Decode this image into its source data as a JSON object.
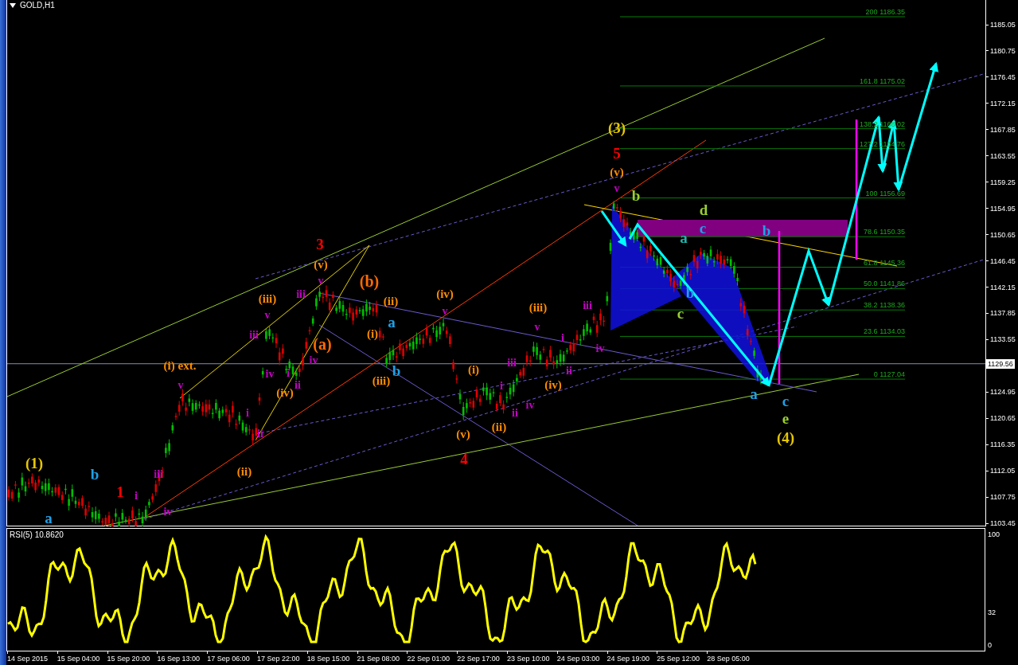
{
  "chart": {
    "title": "GOLD,H1"
  },
  "price_axis": {
    "labels": [
      "1185.05",
      "1180.75",
      "1176.45",
      "1172.15",
      "1167.85",
      "1163.55",
      "1159.25",
      "1154.95",
      "1150.65",
      "1146.45",
      "1142.15",
      "1137.85",
      "1133.55",
      "1124.95",
      "1120.65",
      "1116.35",
      "1112.05",
      "1107.75",
      "1103.45"
    ],
    "current_price": "1129.56"
  },
  "fib_levels": [
    "200 1186.35",
    "161.8 1175.02",
    "138.2 1168.02",
    "127.2 1164.76",
    "100 1156.69",
    "78.6 1150.35",
    "61.8 1145.36",
    "50.0 1141.86",
    "38.2 1138.36",
    "23.6 1134.03",
    "0 1127.04"
  ],
  "waves": [
    {
      "text": "(1)",
      "kind": "primary",
      "color": "#e6c700"
    },
    {
      "text": "a",
      "kind": "primary",
      "color": "#1ea0e6"
    },
    {
      "text": "b",
      "kind": "primary",
      "color": "#1ea0e6"
    },
    {
      "text": "1",
      "kind": "primary",
      "color": "#ff0000"
    },
    {
      "text": "i",
      "kind": "minute",
      "color": "#c000c0"
    },
    {
      "text": "iii",
      "kind": "minute",
      "color": "#c000c0"
    },
    {
      "text": "iv",
      "kind": "minute",
      "color": "#c000c0"
    },
    {
      "text": "(i) ext.",
      "kind": "minor",
      "color": "#ff8c00"
    },
    {
      "text": "v",
      "kind": "minute",
      "color": "#c000c0"
    },
    {
      "text": "i",
      "kind": "minute",
      "color": "#c000c0"
    },
    {
      "text": "ii",
      "kind": "minute",
      "color": "#c000c0"
    },
    {
      "text": "(ii)",
      "kind": "minor",
      "color": "#ff8c00"
    },
    {
      "text": "(iii)",
      "kind": "minor",
      "color": "#ff8c00"
    },
    {
      "text": "v",
      "kind": "minute",
      "color": "#c000c0"
    },
    {
      "text": "iii",
      "kind": "minute",
      "color": "#c000c0"
    },
    {
      "text": "iv",
      "kind": "minute",
      "color": "#c000c0"
    },
    {
      "text": "i",
      "kind": "minute",
      "color": "#c000c0"
    },
    {
      "text": "(iv)",
      "kind": "minor",
      "color": "#ff8c00"
    },
    {
      "text": "ii",
      "kind": "minute",
      "color": "#c000c0"
    },
    {
      "text": "iii",
      "kind": "minute",
      "color": "#c000c0"
    },
    {
      "text": "3",
      "kind": "primary",
      "color": "#ff0000"
    },
    {
      "text": "(v)",
      "kind": "minor",
      "color": "#ff8c00"
    },
    {
      "text": "v",
      "kind": "minute",
      "color": "#c000c0"
    },
    {
      "text": "(a)",
      "kind": "major",
      "color": "#ff6a00"
    },
    {
      "text": "iv",
      "kind": "minute",
      "color": "#c000c0"
    },
    {
      "text": "(b)",
      "kind": "major",
      "color": "#ff6a00"
    },
    {
      "text": "(ii)",
      "kind": "minor",
      "color": "#ff8c00"
    },
    {
      "text": "a",
      "kind": "primary",
      "color": "#1ea0e6"
    },
    {
      "text": "(i)",
      "kind": "minor",
      "color": "#ff8c00"
    },
    {
      "text": "b",
      "kind": "primary",
      "color": "#1ea0e6"
    },
    {
      "text": "(iii)",
      "kind": "minor",
      "color": "#ff8c00"
    },
    {
      "text": "(iv)",
      "kind": "minor",
      "color": "#ff8c00"
    },
    {
      "text": "v",
      "kind": "minute",
      "color": "#c000c0"
    },
    {
      "text": "(i)",
      "kind": "minor",
      "color": "#ff8c00"
    },
    {
      "text": "(v)",
      "kind": "minor",
      "color": "#ff8c00"
    },
    {
      "text": "4",
      "kind": "primary",
      "color": "#ff0000"
    },
    {
      "text": "(ii)",
      "kind": "minor",
      "color": "#ff8c00"
    },
    {
      "text": "i",
      "kind": "minute",
      "color": "#c000c0"
    },
    {
      "text": "ii",
      "kind": "minute",
      "color": "#c000c0"
    },
    {
      "text": "iii",
      "kind": "minute",
      "color": "#c000c0"
    },
    {
      "text": "iv",
      "kind": "minute",
      "color": "#c000c0"
    },
    {
      "text": "(iii)",
      "kind": "minor",
      "color": "#ff8c00"
    },
    {
      "text": "v",
      "kind": "minute",
      "color": "#c000c0"
    },
    {
      "text": "i",
      "kind": "minute",
      "color": "#c000c0"
    },
    {
      "text": "ii",
      "kind": "minute",
      "color": "#c000c0"
    },
    {
      "text": "(iv)",
      "kind": "minor",
      "color": "#ff8c00"
    },
    {
      "text": "iii",
      "kind": "minute",
      "color": "#c000c0"
    },
    {
      "text": "iv",
      "kind": "minute",
      "color": "#c000c0"
    },
    {
      "text": "(3)",
      "kind": "primary",
      "color": "#e6c700"
    },
    {
      "text": "5",
      "kind": "primary",
      "color": "#ff0000"
    },
    {
      "text": "(v)",
      "kind": "minor",
      "color": "#ff8c00"
    },
    {
      "text": "v",
      "kind": "minute",
      "color": "#c000c0"
    },
    {
      "text": "b",
      "kind": "primary",
      "color": "#9acd32"
    },
    {
      "text": "d",
      "kind": "primary",
      "color": "#9acd32"
    },
    {
      "text": "c",
      "kind": "primary",
      "color": "#1ea0e6"
    },
    {
      "text": "a",
      "kind": "primary",
      "color": "#20b2aa"
    },
    {
      "text": "b",
      "kind": "primary",
      "color": "#1ea0e6"
    },
    {
      "text": "c",
      "kind": "primary",
      "color": "#9acd32"
    },
    {
      "text": "b",
      "kind": "primary",
      "color": "#1ea0e6"
    },
    {
      "text": "a",
      "kind": "primary",
      "color": "#1ea0e6"
    },
    {
      "text": "c",
      "kind": "primary",
      "color": "#1ea0e6"
    },
    {
      "text": "e",
      "kind": "primary",
      "color": "#9acd32"
    },
    {
      "text": "(4)",
      "kind": "primary",
      "color": "#e6c700"
    }
  ],
  "rsi": {
    "label": "RSI(5) 10.8620",
    "axis_labels": [
      "100",
      "32",
      "0"
    ]
  },
  "time_axis": [
    "14 Sep 2015",
    "15 Sep 04:00",
    "15 Sep 20:00",
    "16 Sep 13:00",
    "17 Sep 06:00",
    "17 Sep 22:00",
    "18 Sep 15:00",
    "21 Sep 08:00",
    "22 Sep 01:00",
    "22 Sep 17:00",
    "23 Sep 10:00",
    "24 Sep 03:00",
    "24 Sep 19:00",
    "25 Sep 12:00",
    "28 Sep 05:00"
  ]
}
